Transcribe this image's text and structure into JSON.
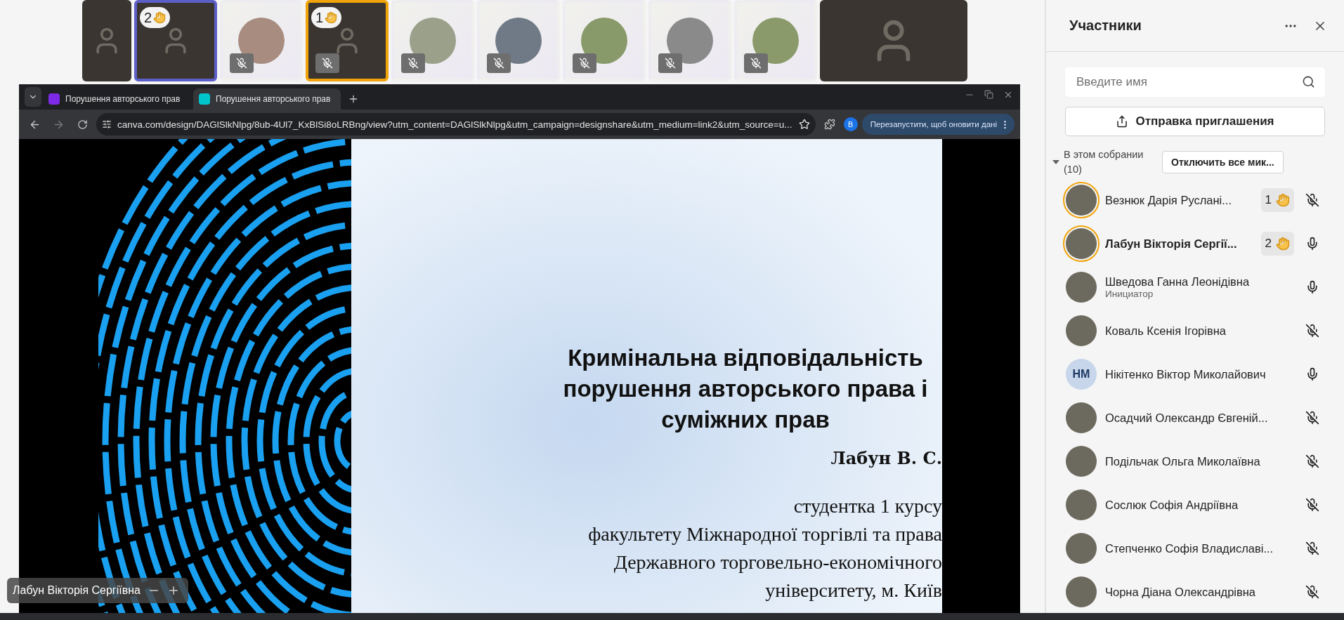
{
  "video_strip": [
    {
      "kind": "video",
      "muted": false,
      "wide": false
    },
    {
      "kind": "video",
      "hand": "2",
      "color": "#5b5fc7",
      "muted": false,
      "wide": false
    },
    {
      "kind": "avatar",
      "muted": true,
      "wide": false
    },
    {
      "kind": "video",
      "hand": "1",
      "color": "#f0a30a",
      "muted": true,
      "wide": false
    },
    {
      "kind": "avatar",
      "muted": true,
      "wide": false
    },
    {
      "kind": "avatar",
      "muted": true,
      "wide": false
    },
    {
      "kind": "avatar",
      "muted": true,
      "wide": false
    },
    {
      "kind": "avatar",
      "muted": true,
      "wide": false
    },
    {
      "kind": "avatar",
      "muted": true,
      "wide": false
    },
    {
      "kind": "video",
      "muted": false,
      "wide": true
    }
  ],
  "browser": {
    "tabs": [
      {
        "title": "Порушення авторського прав",
        "selected": false
      },
      {
        "title": "Порушення авторського прав",
        "selected": true
      }
    ],
    "url": "canva.com/design/DAGlSlkNlpg/8ub-4Ul7_KxBlSi8oLRBng/view?utm_content=DAGlSlkNlpg&utm_campaign=designshare&utm_medium=link2&utm_source=u...",
    "profile": "B",
    "update_button": "Перезапустити, щоб оновити дані"
  },
  "slide": {
    "title": [
      "Кримінальна відповідальність",
      "порушення авторського права і",
      "суміжних прав"
    ],
    "author": "Лабун В. С.",
    "lines": [
      "студентка 1 курсу",
      "факультету Міжнародної торгівлі та права",
      "Державного торговельно-економічного",
      "університету, м. Київ"
    ]
  },
  "presenter_label": "Лабун Вікторія Сергіївна",
  "panel": {
    "title": "Участники",
    "search": {
      "placeholder": "Введите имя"
    },
    "invite_button": "Отправка приглашения",
    "section": {
      "label": "В этом собрании (10)",
      "expanded": true,
      "mute_all": "Отключить все мик..."
    },
    "participants": [
      {
        "name": "Везнюк Дарія Руслані...",
        "hand": "1",
        "muted": true,
        "presenting": false
      },
      {
        "name": "Лабун Вікторія Сергії...",
        "hand": "2",
        "muted": false,
        "presenting": true
      },
      {
        "name": "Шведова Ганна Леонідівна",
        "role": "Инициатор",
        "muted": false,
        "presenting": false
      },
      {
        "name": "Коваль Ксенія Ігорівна",
        "muted": true,
        "presenting": false
      },
      {
        "name": "Нікітенко Віктор Миколайович",
        "initials": "НМ",
        "muted": false,
        "presenting": false
      },
      {
        "name": "Осадчий Олександр Євгеній...",
        "muted": true,
        "presenting": false
      },
      {
        "name": "Подільчак Ольга Миколаївна",
        "muted": true,
        "presenting": false
      },
      {
        "name": "Cослюк Софія Андріївна",
        "muted": true,
        "presenting": false
      },
      {
        "name": "Степченко Софія Владиславі...",
        "muted": true,
        "presenting": false
      },
      {
        "name": "Чорна Діана Олександрівна",
        "muted": true,
        "presenting": false
      }
    ]
  }
}
